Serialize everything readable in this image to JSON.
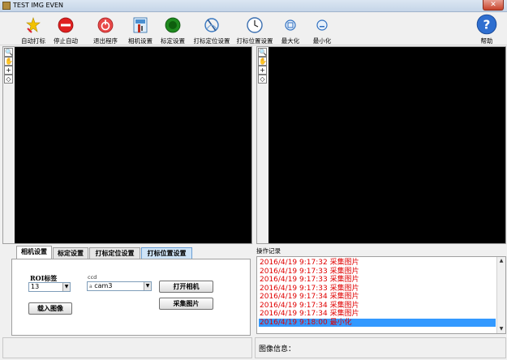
{
  "window": {
    "title": "TEST IMG EVEN",
    "close_glyph": "✕"
  },
  "toolbar": {
    "items": [
      {
        "label": "自动打标",
        "icon": "auto-mark-icon"
      },
      {
        "label": "停止自动",
        "icon": "stop-icon"
      },
      {
        "label": "退出程序",
        "icon": "exit-icon"
      },
      {
        "label": "相机设置",
        "icon": "camera-settings-icon"
      },
      {
        "label": "标定设置",
        "icon": "calibration-icon"
      },
      {
        "label": "打标定位设置",
        "icon": "mark-locate-icon"
      },
      {
        "label": "打标位置设置",
        "icon": "clock-icon"
      },
      {
        "label": "最大化",
        "icon": "maximize-icon"
      },
      {
        "label": "最小化",
        "icon": "minimize-icon"
      }
    ],
    "help_label": "帮助"
  },
  "image_tools": [
    "🔍",
    "✋",
    "+",
    "◇"
  ],
  "tabs": [
    {
      "label": "相机设置"
    },
    {
      "label": "标定设置"
    },
    {
      "label": "打标定位设置"
    },
    {
      "label": "打标位置设置"
    }
  ],
  "camera_settings": {
    "roi_label": "ROI标签",
    "roi_value": "13",
    "ccd_label": "ccd",
    "ccd_value": "cam3",
    "ccd_prefix": "a",
    "load_image_button": "载入图像",
    "open_camera_button": "打开相机",
    "capture_button": "采集图片"
  },
  "log": {
    "title": "操作记录",
    "entries": [
      "2016/4/19 9:17:32 采集图片",
      "2016/4/19 9:17:33 采集图片",
      "2016/4/19 9:17:33 采集图片",
      "2016/4/19 9:17:33 采集图片",
      "2016/4/19 9:17:34 采集图片",
      "2016/4/19 9:17:34 采集图片",
      "2016/4/19 9:17:34 采集图片",
      "2016/4/19 9:18:00 最小化"
    ]
  },
  "status": {
    "image_info_label": "图像信息："
  }
}
